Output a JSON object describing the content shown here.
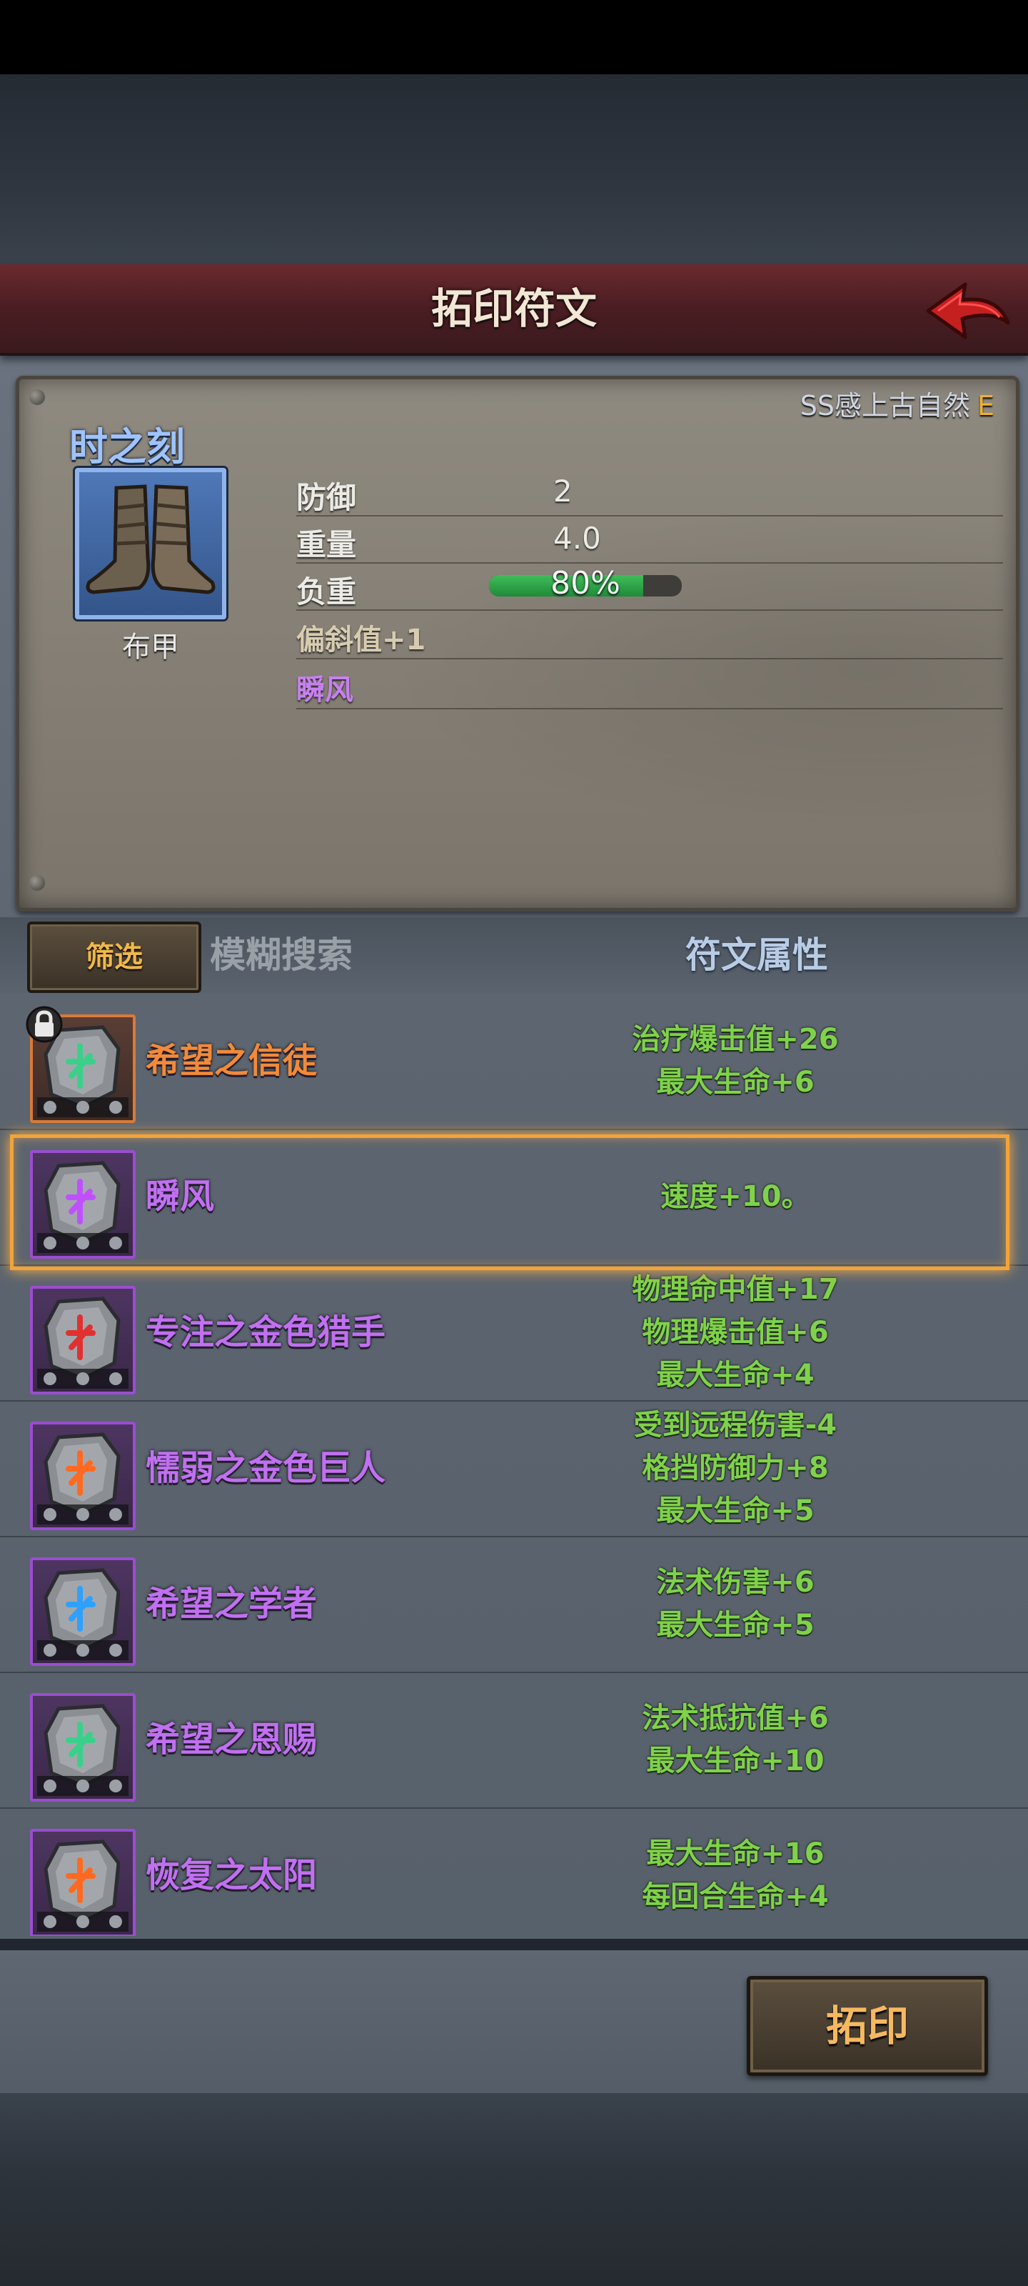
{
  "header": {
    "title": "拓印符文"
  },
  "item": {
    "quality_text": "SS感上古自然",
    "quality_grade": "E",
    "name": "时之刻",
    "type": "布甲",
    "stats": [
      {
        "label": "防御",
        "value": "2"
      },
      {
        "label": "重量",
        "value": "4.0"
      },
      {
        "label": "负重",
        "value": "80%",
        "fill": 0.8
      }
    ],
    "extra": [
      {
        "text": "偏斜值+1",
        "color": "#d8ccb0"
      },
      {
        "text": "瞬风",
        "color": "#c880f0"
      }
    ]
  },
  "search": {
    "filter_label": "筛选",
    "placeholder": "模糊搜索",
    "column_header": "符文属性"
  },
  "runes": [
    {
      "name": "希望之信徒",
      "color": "#f28a3a",
      "frame": "orange",
      "glyph": "#3ad08a",
      "locked": true,
      "attrs": [
        "治疗爆击值+26",
        "最大生命+6"
      ]
    },
    {
      "name": "瞬风",
      "color": "#c070f0",
      "frame": "purple",
      "glyph": "#c050ff",
      "locked": false,
      "selected": true,
      "attrs": [
        "速度+10。"
      ]
    },
    {
      "name": "专注之金色猎手",
      "color": "#c070f0",
      "frame": "purple",
      "glyph": "#e03030",
      "locked": false,
      "attrs": [
        "物理命中值+17",
        "物理爆击值+6",
        "最大生命+4"
      ]
    },
    {
      "name": "懦弱之金色巨人",
      "color": "#c070f0",
      "frame": "purple",
      "glyph": "#ff6a20",
      "locked": false,
      "attrs": [
        "受到远程伤害-4",
        "格挡防御力+8",
        "最大生命+5"
      ]
    },
    {
      "name": "希望之学者",
      "color": "#c070f0",
      "frame": "purple",
      "glyph": "#30a0ff",
      "locked": false,
      "attrs": [
        "法术伤害+6",
        "最大生命+5"
      ]
    },
    {
      "name": "希望之恩赐",
      "color": "#c070f0",
      "frame": "purple",
      "glyph": "#3ad08a",
      "locked": false,
      "attrs": [
        "法术抵抗值+6",
        "最大生命+10"
      ]
    },
    {
      "name": "恢复之太阳",
      "color": "#c070f0",
      "frame": "purple",
      "glyph": "#ff6a20",
      "locked": false,
      "attrs": [
        "最大生命+16",
        "每回合生命+4"
      ]
    }
  ],
  "actions": {
    "print_label": "拓印"
  }
}
